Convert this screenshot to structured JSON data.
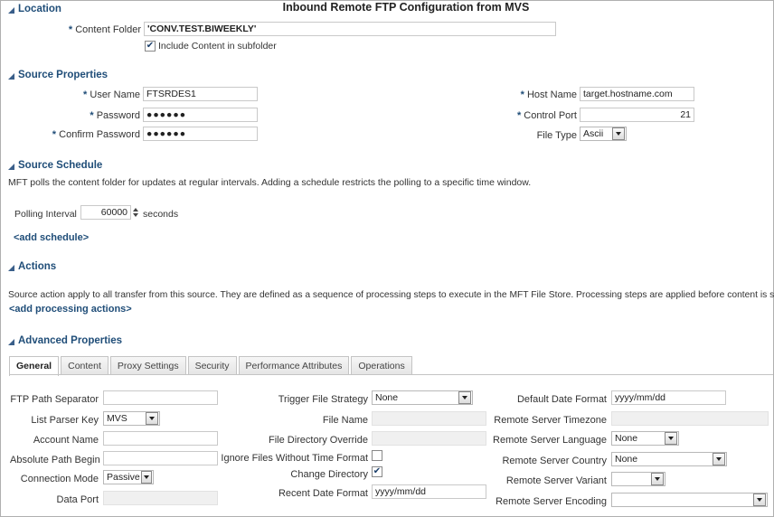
{
  "page_title": "Inbound Remote FTP Configuration from MVS",
  "location": {
    "heading": "Location",
    "content_folder_label": "Content Folder",
    "content_folder_value": "'CONV.TEST.BIWEEKLY'",
    "include_subfolder_label": "Include Content in subfolder",
    "include_subfolder_checked": true
  },
  "source_properties": {
    "heading": "Source Properties",
    "user_name_label": "User Name",
    "user_name_value": "FTSRDES1",
    "password_label": "Password",
    "password_value": "●●●●●●",
    "confirm_password_label": "Confirm Password",
    "confirm_password_value": "●●●●●●",
    "host_name_label": "Host Name",
    "host_name_value": "target.hostname.com",
    "control_port_label": "Control Port",
    "control_port_value": "21",
    "file_type_label": "File Type",
    "file_type_value": "Ascii"
  },
  "source_schedule": {
    "heading": "Source Schedule",
    "description": "MFT polls the content folder for updates at regular intervals. Adding a schedule restricts the polling to a specific time window.",
    "polling_interval_label": "Polling Interval",
    "polling_interval_value": "60000",
    "polling_interval_unit": "seconds",
    "add_schedule_link": "<add schedule>"
  },
  "actions": {
    "heading": "Actions",
    "description": "Source action apply to all transfer from this source. They are defined as a sequence of processing steps to execute in the MFT File Store. Processing steps are applied before content is sent to",
    "add_actions_link": "<add processing actions>"
  },
  "advanced": {
    "heading": "Advanced Properties",
    "tabs": [
      {
        "label": "General",
        "active": true
      },
      {
        "label": "Content",
        "active": false
      },
      {
        "label": "Proxy Settings",
        "active": false
      },
      {
        "label": "Security",
        "active": false
      },
      {
        "label": "Performance Attributes",
        "active": false
      },
      {
        "label": "Operations",
        "active": false
      }
    ],
    "col1": {
      "ftp_path_separator_label": "FTP Path Separator",
      "ftp_path_separator_value": "",
      "list_parser_key_label": "List Parser Key",
      "list_parser_key_value": "MVS",
      "account_name_label": "Account Name",
      "account_name_value": "",
      "absolute_path_begin_label": "Absolute Path Begin",
      "absolute_path_begin_value": "",
      "connection_mode_label": "Connection Mode",
      "connection_mode_value": "Passive",
      "data_port_label": "Data Port",
      "data_port_value": ""
    },
    "col2": {
      "trigger_file_strategy_label": "Trigger File Strategy",
      "trigger_file_strategy_value": "None",
      "file_name_label": "File Name",
      "file_name_value": "",
      "file_directory_override_label": "File Directory Override",
      "file_directory_override_value": "",
      "ignore_files_label": "Ignore Files Without Time Format",
      "ignore_files_checked": false,
      "change_directory_label": "Change Directory",
      "change_directory_checked": true,
      "recent_date_format_label": "Recent Date Format",
      "recent_date_format_value": "yyyy/mm/dd"
    },
    "col3": {
      "default_date_format_label": "Default Date Format",
      "default_date_format_value": "yyyy/mm/dd",
      "remote_server_timezone_label": "Remote Server Timezone",
      "remote_server_timezone_value": "",
      "remote_server_language_label": "Remote Server Language",
      "remote_server_language_value": "None",
      "remote_server_country_label": "Remote Server Country",
      "remote_server_country_value": "None",
      "remote_server_variant_label": "Remote Server Variant",
      "remote_server_variant_value": "",
      "remote_server_encoding_label": "Remote Server Encoding",
      "remote_server_encoding_value": ""
    }
  }
}
